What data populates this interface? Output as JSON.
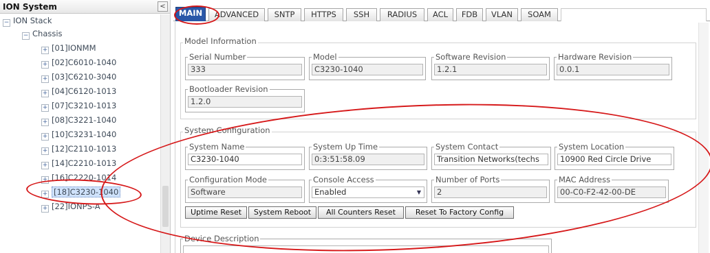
{
  "tree": {
    "title": "ION System",
    "collapse_glyph": "<",
    "nodes": [
      {
        "label": "ION Stack",
        "exp": "−"
      },
      {
        "label": "Chassis",
        "exp": "−"
      },
      {
        "label": "[01]IONMM",
        "exp": "+"
      },
      {
        "label": "[02]C6010-1040",
        "exp": "+"
      },
      {
        "label": "[03]C6210-3040",
        "exp": "+"
      },
      {
        "label": "[04]C6120-1013",
        "exp": "+"
      },
      {
        "label": "[07]C3210-1013",
        "exp": "+"
      },
      {
        "label": "[08]C3221-1040",
        "exp": "+"
      },
      {
        "label": "[10]C3231-1040",
        "exp": "+"
      },
      {
        "label": "[12]C2110-1013",
        "exp": "+"
      },
      {
        "label": "[14]C2210-1013",
        "exp": "+"
      },
      {
        "label": "[16]C2220-1014",
        "exp": "+"
      },
      {
        "label": "[18]C3230-1040",
        "exp": "+",
        "selected": true
      },
      {
        "label": "[22]IONPS-A",
        "exp": "+"
      }
    ]
  },
  "tabs": [
    "MAIN",
    "ADVANCED",
    "SNTP",
    "HTTPS",
    "SSH",
    "RADIUS",
    "ACL",
    "FDB",
    "VLAN",
    "SOAM"
  ],
  "active_tab": "MAIN",
  "model_info": {
    "title": "Model Information",
    "serial_number": {
      "label": "Serial Number",
      "value": "333"
    },
    "model": {
      "label": "Model",
      "value": "C3230-1040"
    },
    "software_revision": {
      "label": "Software Revision",
      "value": "1.2.1"
    },
    "hardware_revision": {
      "label": "Hardware Revision",
      "value": "0.0.1"
    },
    "bootloader_revision": {
      "label": "Bootloader Revision",
      "value": "1.2.0"
    }
  },
  "system_config": {
    "title": "System Configuration",
    "system_name": {
      "label": "System Name",
      "value": "C3230-1040"
    },
    "system_up_time": {
      "label": "System Up Time",
      "value": "0:3:51:58.09"
    },
    "system_contact": {
      "label": "System Contact",
      "value": "Transition Networks(techs"
    },
    "system_location": {
      "label": "System Location",
      "value": "10900 Red Circle Drive"
    },
    "configuration_mode": {
      "label": "Configuration Mode",
      "value": "Software"
    },
    "console_access": {
      "label": "Console Access",
      "value": "Enabled"
    },
    "number_of_ports": {
      "label": "Number of Ports",
      "value": "2"
    },
    "mac_address": {
      "label": "MAC Address",
      "value": "00-C0-F2-42-00-DE"
    }
  },
  "buttons": {
    "uptime_reset": "Uptime Reset",
    "system_reboot": "System Reboot",
    "all_counters_reset": "All Counters Reset",
    "reset_factory": "Reset To Factory Config"
  },
  "device_description": {
    "label": "Device Description",
    "value": ""
  },
  "colors": {
    "active_tab": "#2a57a8",
    "annotation": "#d6191a",
    "selection": "#cfe2fb"
  }
}
